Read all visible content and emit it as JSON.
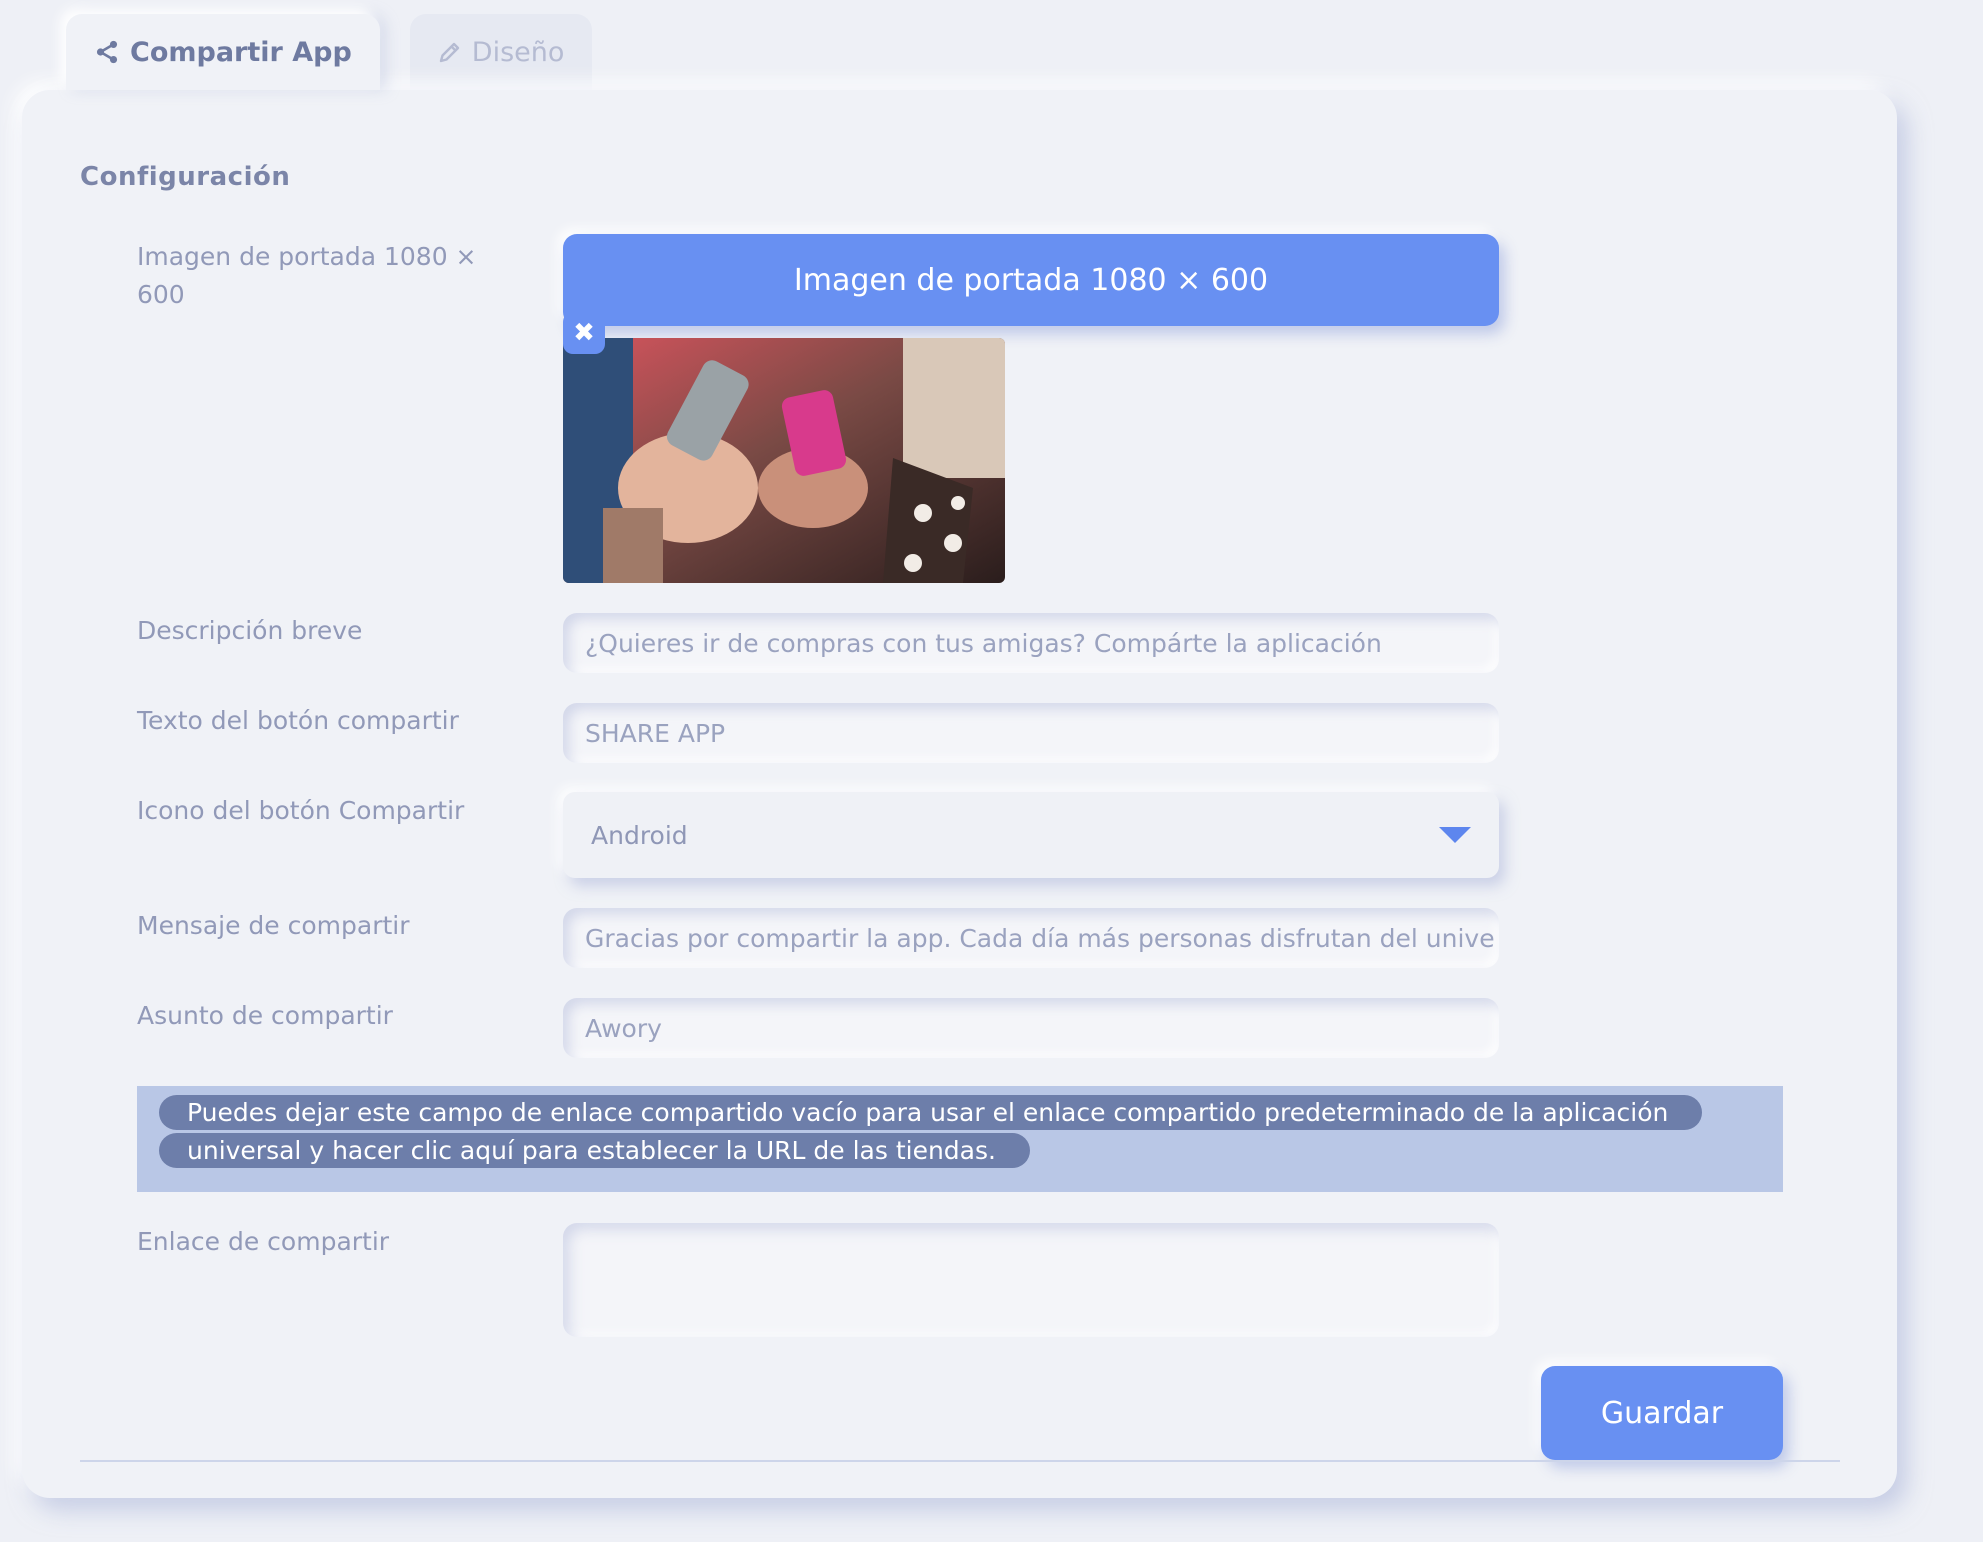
{
  "tabs": [
    {
      "label": "Compartir App",
      "icon": "share-icon",
      "active": true
    },
    {
      "label": "Diseño",
      "icon": "pencil-icon",
      "active": false
    }
  ],
  "section_title": "Configuración",
  "cover": {
    "label": "Imagen de portada 1080 × 600",
    "button_label": "Imagen de portada 1080 × 600",
    "remove_icon": "close-icon"
  },
  "fields": {
    "short_description": {
      "label": "Descripción breve",
      "value": "¿Quieres ir de compras con tus amigas? Compárte la aplicación"
    },
    "share_button_text": {
      "label": "Texto del botón compartir",
      "value": "SHARE APP"
    },
    "share_button_icon": {
      "label": "Icono del botón Compartir",
      "value": "Android"
    },
    "share_message": {
      "label": "Mensaje de compartir",
      "value": "Gracias por compartir la app. Cada día más personas disfrutan del unive"
    },
    "share_subject": {
      "label": "Asunto de compartir",
      "value": "Awory"
    },
    "share_link": {
      "label": "Enlace de compartir",
      "value": ""
    }
  },
  "notice": "Puedes dejar este campo de enlace compartido vacío para usar el enlace compartido predeterminado de la aplicación universal y hacer clic aquí para establecer la URL de las tiendas.",
  "save_label": "Guardar",
  "colors": {
    "accent": "#6890f2",
    "background": "#eef0f6",
    "notice_bg": "#b9c7e6",
    "notice_highlight": "#6d7eaa"
  }
}
